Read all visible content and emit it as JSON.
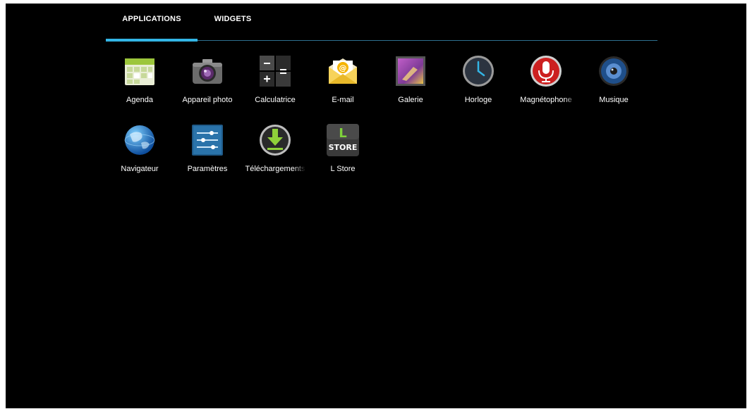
{
  "tabs": {
    "applications": "APPLICATIONS",
    "widgets": "WIDGETS"
  },
  "apps": [
    {
      "label": "Agenda",
      "icon": "calendar-icon"
    },
    {
      "label": "Appareil photo",
      "icon": "camera-icon"
    },
    {
      "label": "Calculatrice",
      "icon": "calculator-icon"
    },
    {
      "label": "E-mail",
      "icon": "email-icon"
    },
    {
      "label": "Galerie",
      "icon": "gallery-icon"
    },
    {
      "label": "Horloge",
      "icon": "clock-icon"
    },
    {
      "label": "Magnétophone",
      "icon": "microphone-icon"
    },
    {
      "label": "Musique",
      "icon": "speaker-icon"
    },
    {
      "label": "Navigateur",
      "icon": "globe-icon"
    },
    {
      "label": "Paramètres",
      "icon": "settings-sliders-icon"
    },
    {
      "label": "Téléchargements",
      "icon": "download-icon"
    },
    {
      "label": "L Store",
      "icon": "lstore-icon",
      "icon_text_top": "L",
      "icon_text_bottom": "STORE"
    }
  ],
  "colors": {
    "accent": "#33b5e5",
    "background": "#000000",
    "text": "#ffffff"
  }
}
